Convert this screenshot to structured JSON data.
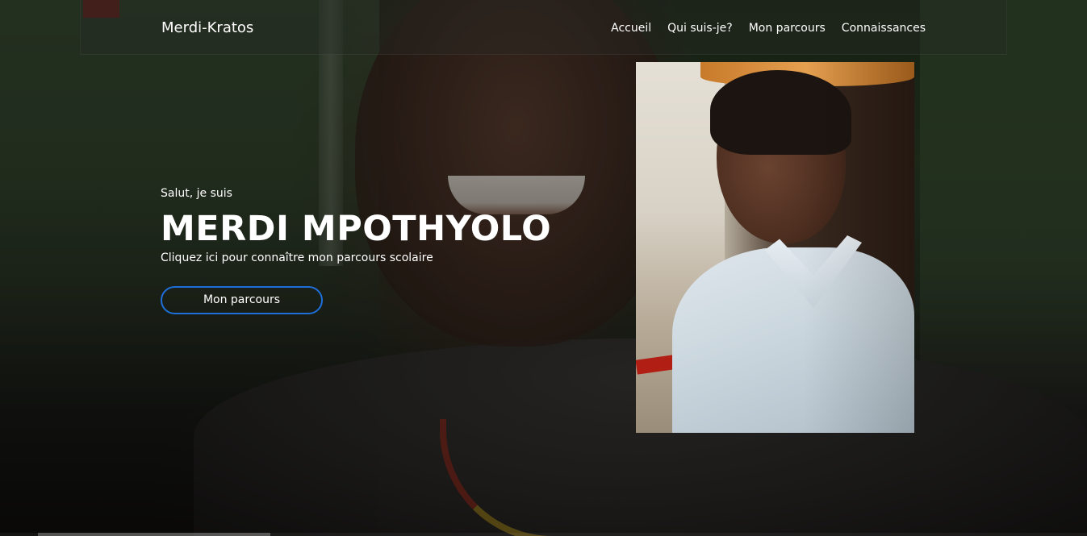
{
  "navbar": {
    "brand": "Merdi-Kratos",
    "links": [
      {
        "label": "Accueil"
      },
      {
        "label": "Qui suis-je?"
      },
      {
        "label": "Mon parcours"
      },
      {
        "label": "Connaissances"
      }
    ]
  },
  "hero": {
    "greeting": "Salut, je suis",
    "name": "MERDI MPOTHYOLO",
    "tagline": "Cliquez ici pour connaître mon parcours scolaire",
    "cta_label": "Mon parcours"
  },
  "colors": {
    "accent": "#1e6fd9",
    "text": "#ffffff"
  }
}
